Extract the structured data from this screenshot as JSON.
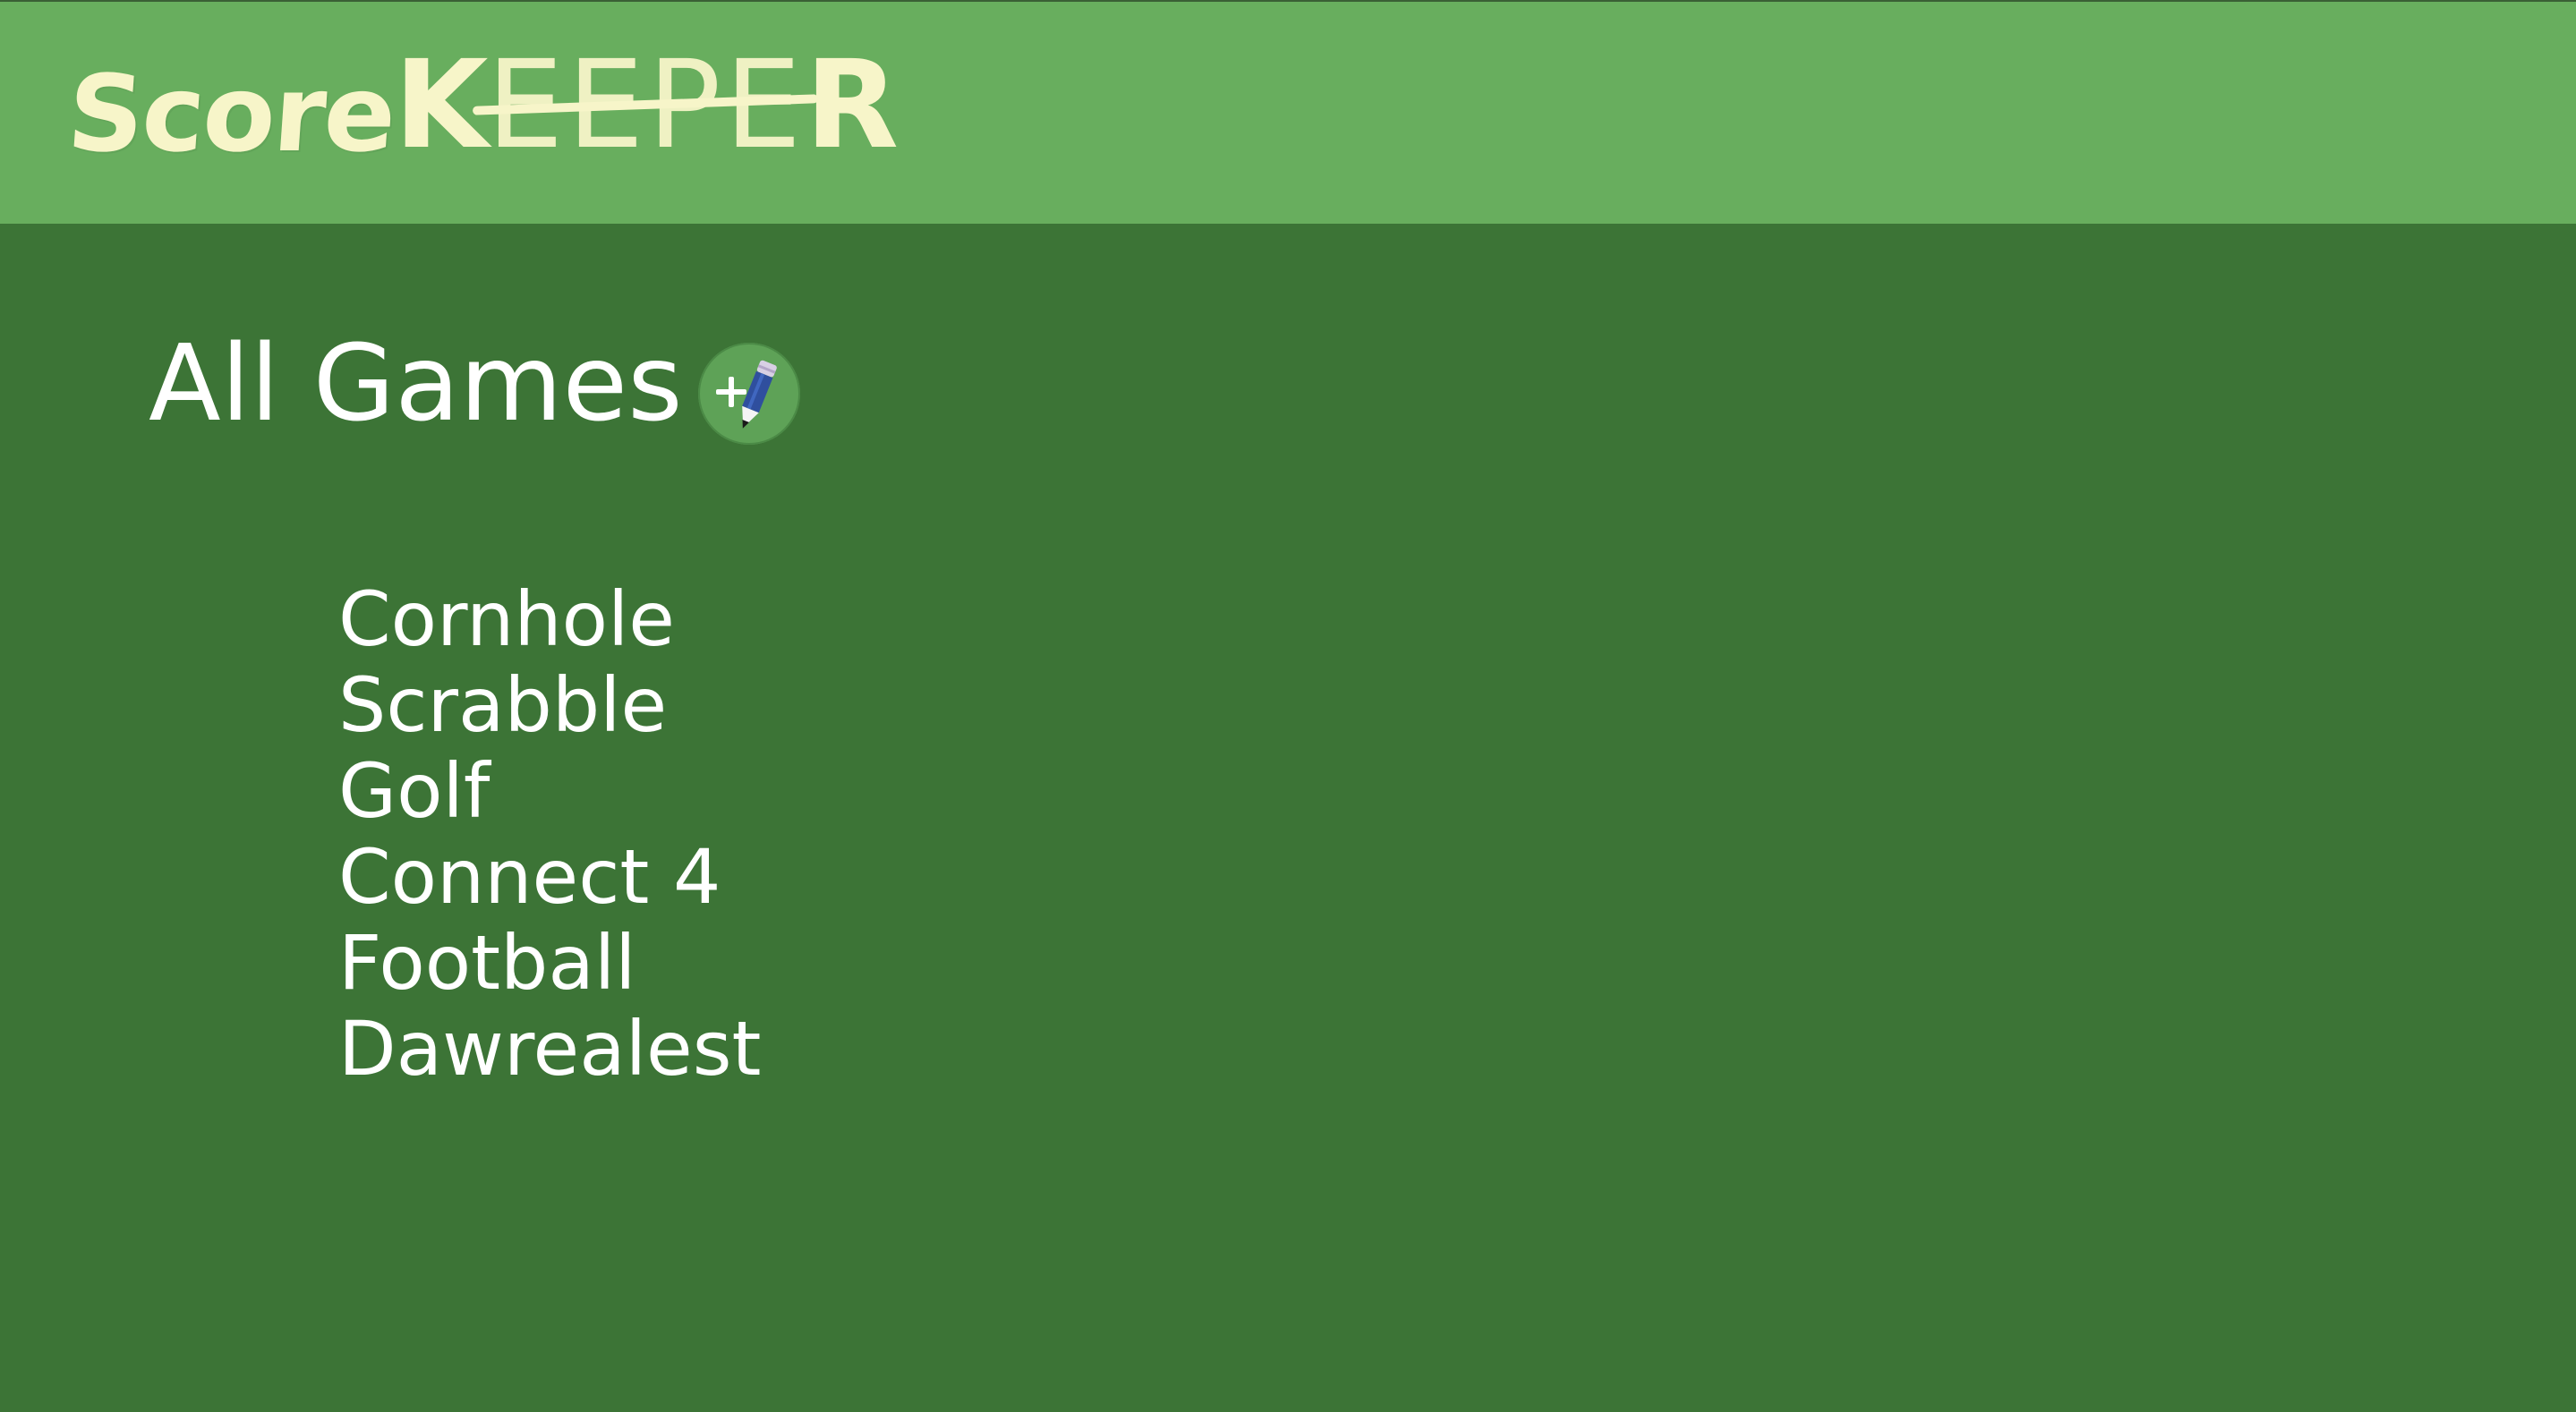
{
  "app": {
    "logo_part1": "Score",
    "logo_part2_first": "K",
    "logo_part2_middle": "EEPE",
    "logo_part2_last": "R"
  },
  "main": {
    "title": "All Games",
    "add_button_icon": "add-pencil-icon",
    "games": [
      "Cornhole",
      "Scrabble",
      "Golf",
      "Connect 4",
      "Football",
      "Dawrealest"
    ]
  },
  "colors": {
    "header_bg": "#68ae5e",
    "page_bg": "#3c7436",
    "logo_text": "#f7f5c9",
    "text": "#ffffff",
    "button_bg": "#5ea257",
    "pencil_body": "#2f4f9e"
  }
}
